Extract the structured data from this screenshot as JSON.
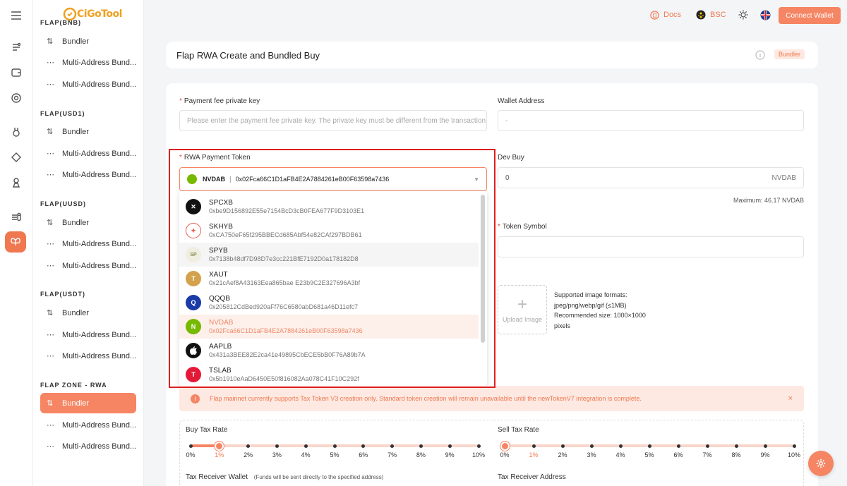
{
  "header": {
    "logo_text": "CiGoTool",
    "docs_label": "Docs",
    "chain_label": "BSC",
    "connect_label": "Connect Wallet"
  },
  "nav": {
    "groups": [
      {
        "title": "FLAP(BNB)",
        "items": [
          "Bundler",
          "Multi-Address Bund...",
          "Multi-Address Bund..."
        ]
      },
      {
        "title": "FLAP(USD1)",
        "items": [
          "Bundler",
          "Multi-Address Bund...",
          "Multi-Address Bund..."
        ]
      },
      {
        "title": "FLAP(UUSD)",
        "items": [
          "Bundler",
          "Multi-Address Bund...",
          "Multi-Address Bund..."
        ]
      },
      {
        "title": "FLAP(USDT)",
        "items": [
          "Bundler",
          "Multi-Address Bund...",
          "Multi-Address Bund..."
        ]
      },
      {
        "title": "FLAP ZONE - RWA",
        "items": [
          "Bundler",
          "Multi-Address Bund...",
          "Multi-Address Bund..."
        ]
      }
    ]
  },
  "page": {
    "title": "Flap RWA Create and Bundled Buy",
    "badge": "Bundler"
  },
  "form": {
    "fee_key_label": "Payment fee private key",
    "fee_key_placeholder": "Please enter the payment fee private key. The private key must be different from the transaction p",
    "wallet_label": "Wallet Address",
    "wallet_value": "-",
    "rwa_token_label": "RWA Payment Token",
    "rwa_token_selected_symbol": "NVDAB",
    "rwa_token_selected_address": "0x02Fca66C1D1aFB4E2A7884261eB00F63598a7436",
    "dev_buy_label": "Dev Buy",
    "dev_buy_value": "0",
    "dev_buy_unit": "NVDAB",
    "dev_buy_max": "Maximum: 46.17 NVDAB",
    "token_symbol_label": "Token Symbol",
    "upload_label": "Upload Image",
    "upload_hint_1": "Supported image formats:",
    "upload_hint_2": "jpeg/png/webp/gif (≤1MB)",
    "upload_hint_3": "Recommended size: 1000×1000",
    "upload_hint_4": "pixels"
  },
  "tokens": [
    {
      "symbol": "SPCXB",
      "address": "0xbe9D156892E55e7154BcD3cB0FEA677F9D3103E1",
      "color": "#111111",
      "glyph": "✕"
    },
    {
      "symbol": "SKHYB",
      "address": "0xCA750eF65f295BBECd685Abf54e82CAf297BDB61",
      "color": "#e85d4a",
      "glyph": "✦"
    },
    {
      "symbol": "SPYB",
      "address": "0x7138b48df7D98D7e3cc221BfE7192D0a178182D8",
      "color": "#c9c9a8",
      "glyph": "SP"
    },
    {
      "symbol": "XAUT",
      "address": "0x21cAef8A43163Eea865bae E23b9C2E327696A3bf",
      "color": "#d4a24c",
      "glyph": "T"
    },
    {
      "symbol": "QQQB",
      "address": "0x205812CdBed920aFf76C6580abD681a46D11efc7",
      "color": "#1a3aa8",
      "glyph": "Q"
    },
    {
      "symbol": "NVDAB",
      "address": "0x02Fca66C1D1aFB4E2A7884261eB00F63598a7436",
      "color": "#76b900",
      "glyph": "N"
    },
    {
      "symbol": "AAPLB",
      "address": "0x431a3BEE82E2ca41e49895CbECE5bB0F76A89b7A",
      "color": "#111111",
      "glyph": ""
    },
    {
      "symbol": "TSLAB",
      "address": "0x5b1910eAaD6450E50f816082Aa078C41F10C292f",
      "color": "#e31937",
      "glyph": "T"
    }
  ],
  "alert": {
    "text": "Flap mainnet currently supports Tax Token V3 creation only. Standard token creation will remain unavailable until the newTokenV7 integration is complete."
  },
  "tax": {
    "buy_label": "Buy Tax Rate",
    "sell_label": "Sell Tax Rate",
    "ticks": [
      "0%",
      "1%",
      "2%",
      "3%",
      "4%",
      "5%",
      "6%",
      "7%",
      "8%",
      "9%",
      "10%"
    ],
    "buy_value_percent": 1,
    "sell_value_percent": 1,
    "receiver_wallet_label": "Tax Receiver Wallet",
    "receiver_wallet_note": "(Funds will be sent directly to the specified address)",
    "receiver_address_label": "Tax Receiver Address"
  },
  "colors": {
    "accent": "#f58563",
    "highlight_border": "#e02020"
  }
}
